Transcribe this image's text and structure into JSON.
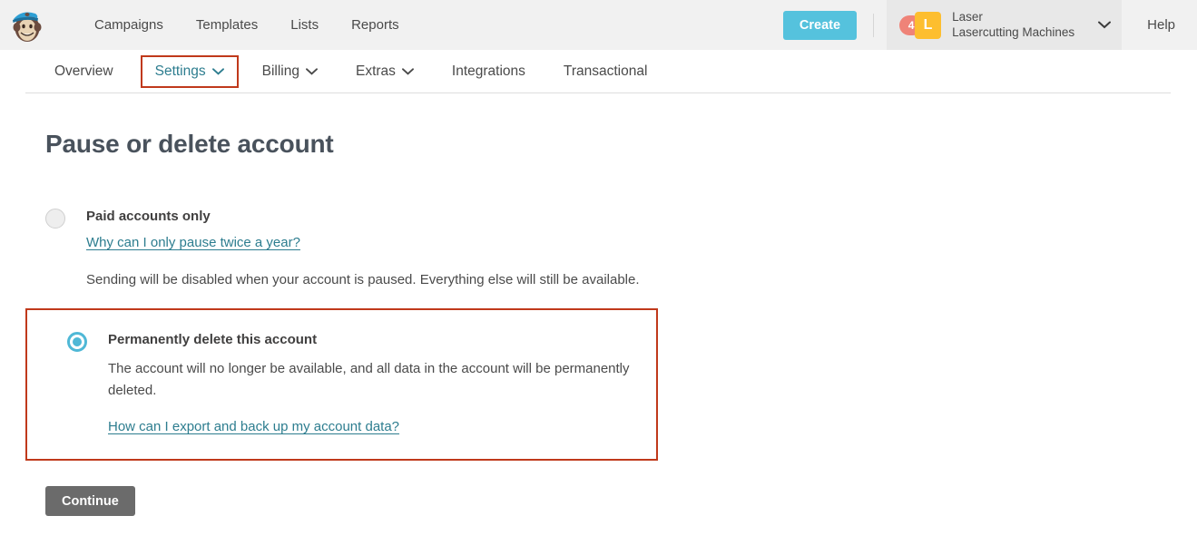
{
  "header": {
    "logo_alt": "Mailchimp Freddie logo",
    "nav": [
      {
        "label": "Campaigns"
      },
      {
        "label": "Templates"
      },
      {
        "label": "Lists"
      },
      {
        "label": "Reports"
      }
    ],
    "create_label": "Create",
    "account": {
      "badge_count": "4",
      "avatar_initial": "L",
      "name": "Laser",
      "company": "Lasercutting Machines"
    },
    "help_label": "Help"
  },
  "tabs": [
    {
      "label": "Overview",
      "has_caret": false,
      "active": false,
      "highlighted": false
    },
    {
      "label": "Settings",
      "has_caret": true,
      "active": true,
      "highlighted": true
    },
    {
      "label": "Billing",
      "has_caret": true,
      "active": false,
      "highlighted": false
    },
    {
      "label": "Extras",
      "has_caret": true,
      "active": false,
      "highlighted": false
    },
    {
      "label": "Integrations",
      "has_caret": false,
      "active": false,
      "highlighted": false
    },
    {
      "label": "Transactional",
      "has_caret": false,
      "active": false,
      "highlighted": false
    }
  ],
  "page": {
    "title": "Pause or delete account"
  },
  "options": {
    "pause": {
      "title": "Paid accounts only",
      "link": "Why can I only pause twice a year?",
      "description": "Sending will be disabled when your account is paused. Everything else will still be available.",
      "selected": false
    },
    "delete": {
      "title": "Permanently delete this account",
      "description": "The account will no longer be available, and all data in the account will be permanently deleted.",
      "link": "How can I export and back up my account data?",
      "selected": true
    }
  },
  "actions": {
    "continue_label": "Continue"
  },
  "colors": {
    "accent_teal": "#2d7d8f",
    "create_blue": "#55c2dd",
    "radio_selected": "#4fb8d6",
    "highlight_red": "#c0391b",
    "avatar_yellow": "#fdbe2f",
    "badge_salmon": "#ef8378",
    "button_gray": "#6b6b6b"
  }
}
